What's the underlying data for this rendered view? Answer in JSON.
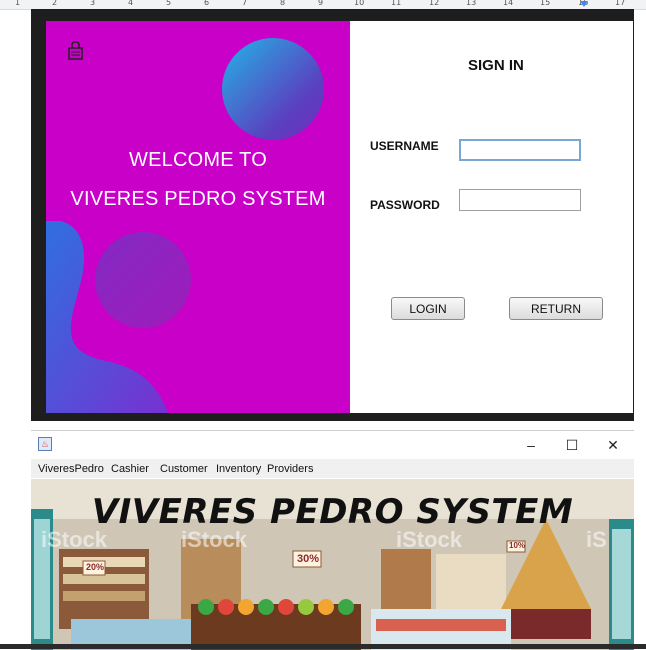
{
  "ruler": {
    "marks": [
      "1",
      "2",
      "3",
      "4",
      "5",
      "6",
      "7",
      "8",
      "9",
      "10",
      "11",
      "12",
      "13",
      "14",
      "15",
      "16",
      "17"
    ]
  },
  "login_window": {
    "welcome_line1": "WELCOME TO",
    "welcome_line2": "VIVERES PEDRO SYSTEM",
    "sign_in_title": "SIGN IN",
    "username_label": "USERNAME",
    "username_value": "",
    "password_label": "PASSWORD",
    "password_value": "",
    "login_button": "LOGIN",
    "return_button": "RETURN",
    "icons": [
      "lock-icon"
    ],
    "colors": {
      "left_panel": "#c800c8",
      "window_frame": "#1e1e1e"
    }
  },
  "main_window": {
    "title_controls": {
      "minimize": "–",
      "maximize": "☐",
      "close": "✕"
    },
    "menu": [
      "ViveresPedro",
      "Cashier",
      "Customer",
      "Inventory",
      "Providers"
    ],
    "banner_title": "VIVERES PEDRO SYSTEM",
    "banner_signs": [
      "20%",
      "30%",
      "10%"
    ],
    "watermark_text": [
      "iStock",
      "iStock",
      "iStock",
      "iS"
    ]
  }
}
